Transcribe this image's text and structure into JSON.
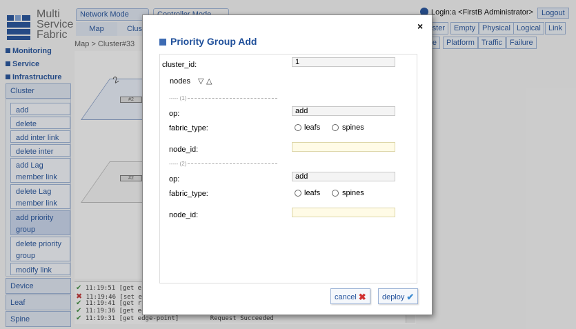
{
  "logo": {
    "line1": "Multi",
    "line2": "Service",
    "line3": "Fabric"
  },
  "nav": {
    "monitoring": "Monitoring",
    "service": "Service",
    "infrastructure": "Infrastructure",
    "cluster": "Cluster",
    "items": [
      "add",
      "delete",
      "add inter link",
      "delete inter link",
      "add Lag member link",
      "delete Lag member link",
      "add priority group",
      "delete priority group",
      "modify link cost"
    ],
    "device": "Device",
    "leaf": "Leaf",
    "spine": "Spine"
  },
  "tabs": {
    "network_mode": "Network Mode",
    "controller_mode": "Controller Mode",
    "map": "Map",
    "cluster": "Cluster"
  },
  "breadcrumb": "Map > Cluster#33",
  "map": {
    "label_2": "2",
    "sw1": "#2",
    "sw2": "#2"
  },
  "user": {
    "login": "Login:a <FirstB Administrator>",
    "logout": "Logout"
  },
  "right_buttons": {
    "row1": [
      "Cluster",
      "Empty",
      "Physical",
      "Logical",
      "Link"
    ],
    "row2": [
      "Device",
      "Platform",
      "Traffic",
      "Failure"
    ]
  },
  "log": [
    {
      "status": "ok",
      "time": "11:19:51",
      "cmd": "[get e"
    },
    {
      "status": "error",
      "time": "11:19:46",
      "cmd": "[set e"
    },
    {
      "status": "ok",
      "time": "11:19:41",
      "cmd": "[get r"
    },
    {
      "status": "ok",
      "time": "11:19:36",
      "cmd": "[get edge-point]"
    },
    {
      "status": "ok",
      "time": "11:19:31",
      "cmd": "[get edge-point]",
      "result": "Request Succeeded"
    }
  ],
  "dialog": {
    "title": "Priority Group Add",
    "close": "×",
    "cluster_id_label": "cluster_id:",
    "cluster_id_value": "1",
    "nodes_label": "nodes",
    "nodes_down": "▽",
    "nodes_up": "△",
    "entries": [
      {
        "sep": "----- (1)",
        "op_label": "op:",
        "op_value": "add",
        "fabric_label": "fabric_type:",
        "opt_leafs": "leafs",
        "opt_spines": "spines",
        "node_id_label": "node_id:",
        "node_id_value": ""
      },
      {
        "sep": "----- (2)",
        "op_label": "op:",
        "op_value": "add",
        "fabric_label": "fabric_type:",
        "opt_leafs": "leafs",
        "opt_spines": "spines",
        "node_id_label": "node_id:",
        "node_id_value": ""
      }
    ],
    "cancel": "cancel",
    "deploy": "deploy"
  },
  "colors": {
    "brand": "#1f4f9a",
    "error": "#d03030",
    "ok": "#3a8a3a"
  }
}
